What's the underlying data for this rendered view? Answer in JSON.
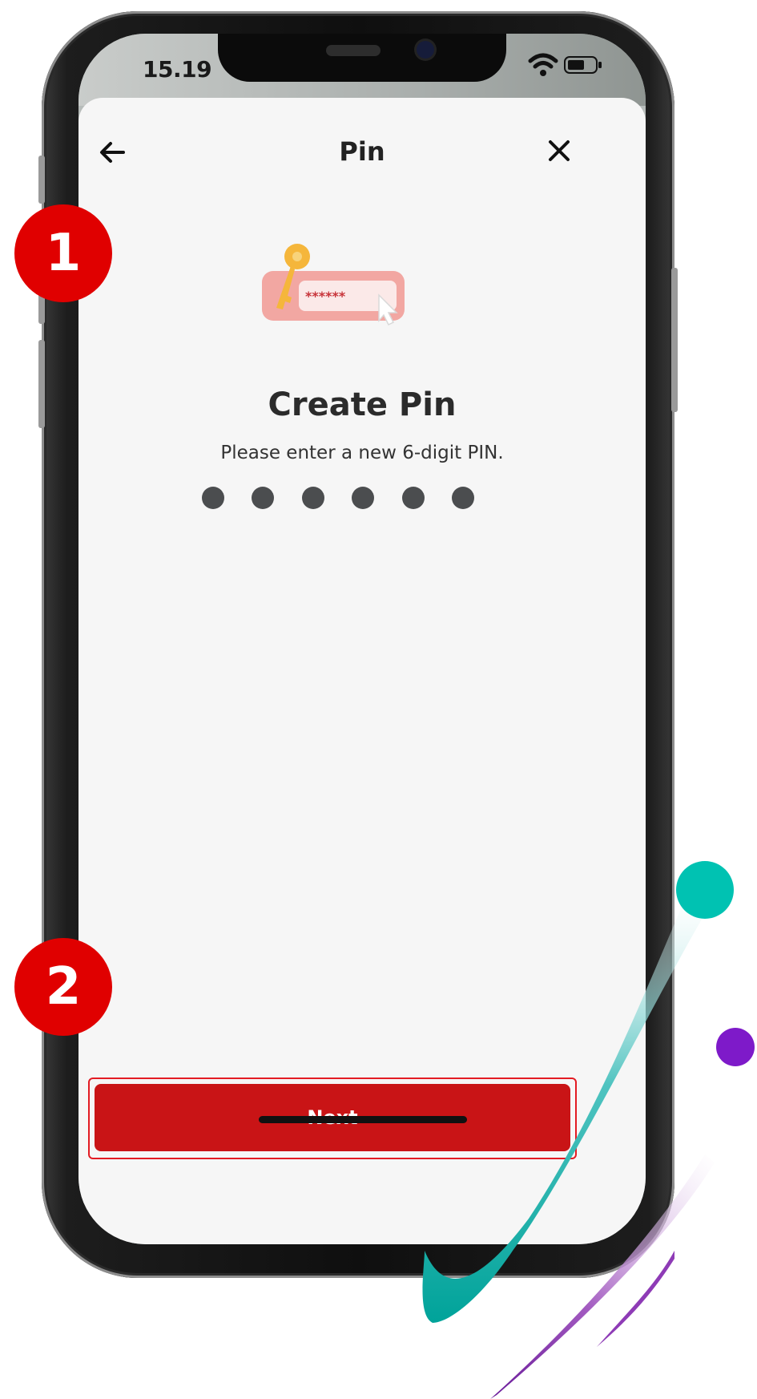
{
  "status_bar": {
    "time": "15.19"
  },
  "nav": {
    "title": "Pin"
  },
  "content": {
    "illustration_mask": "******",
    "headline": "Create Pin",
    "subtitle": "Please enter a new 6-digit PIN.",
    "pin_length": 6,
    "pin_filled": 6
  },
  "footer": {
    "next_label": "Next"
  },
  "callouts": {
    "badge_1": "1",
    "badge_2": "2"
  },
  "colors": {
    "accent_red": "#c91416",
    "badge_red": "#e00000",
    "teal": "#00b4a6",
    "purple": "#7b1fa2"
  }
}
